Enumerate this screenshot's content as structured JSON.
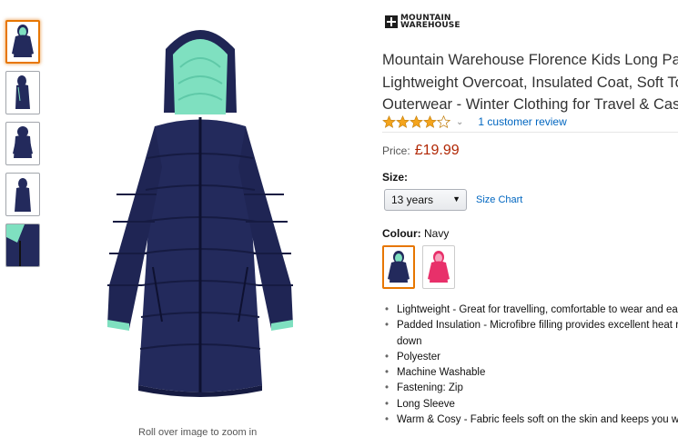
{
  "brand": {
    "line1": "MOUNTAIN",
    "line2": "WAREHOUSE"
  },
  "product": {
    "title_lines": [
      "Mountain Warehouse Florence Kids Long Padded Jacket -",
      "Lightweight Overcoat, Insulated Coat, Soft Touch",
      "Outerwear - Winter Clothing for Travel & Casual Wear"
    ],
    "rating": 4,
    "review_link": "1 customer review",
    "price_label": "Price:",
    "price": "£19.99",
    "size_label": "Size:",
    "size_selected": "13 years",
    "size_chart": "Size Chart",
    "colour_label": "Colour:",
    "colour_value": "Navy",
    "bullets": [
      "Lightweight - Great for travelling, comfortable to wear and easy to pack",
      "Padded Insulation - Microfibre filling provides excellent heat retention like",
      "down",
      "Polyester",
      "Machine Washable",
      "Fastening: Zip",
      "Long Sleeve",
      "Warm & Cosy - Fabric feels soft on the skin and keeps you warm"
    ]
  },
  "image": {
    "zoom_hint": "Roll over image to zoom in"
  },
  "colors": {
    "navy": "#232a5c",
    "mint": "#7fe0c0",
    "pink": "#e8306a",
    "price": "#b12704",
    "link": "#0066c0"
  }
}
